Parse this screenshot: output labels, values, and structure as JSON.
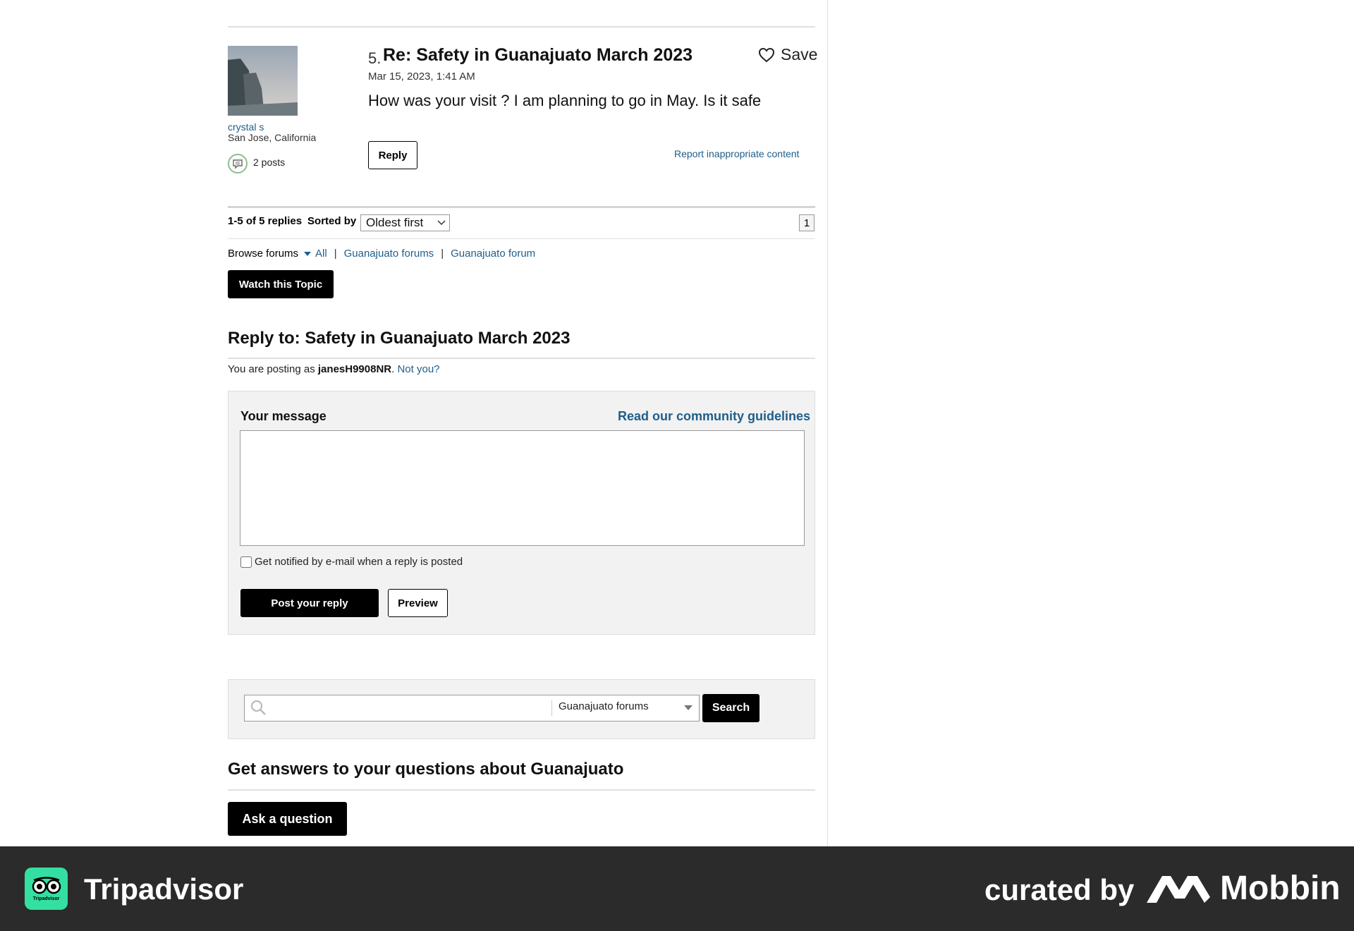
{
  "post": {
    "number": "5.",
    "title": "Re: Safety in Guanajuato March 2023",
    "save_label": "Save",
    "date": "Mar 15, 2023, 1:41 AM",
    "body": "How was your visit ? I am planning to go in May. Is it safe",
    "reply_label": "Reply",
    "report_label": "Report inappropriate content",
    "author": {
      "name": "crystal s",
      "location": "San Jose, California",
      "posts": "2 posts"
    }
  },
  "pagination": {
    "count": "1-5 of 5 replies",
    "sorted_by_label": "Sorted by",
    "sort_value": "Oldest first",
    "page": "1"
  },
  "browse": {
    "label": "Browse forums",
    "all": "All",
    "link1": "Guanajuato forums",
    "link2": "Guanajuato forum",
    "sep": "|"
  },
  "watch_label": "Watch this Topic",
  "reply_form": {
    "heading": "Reply to: Safety in Guanajuato March 2023",
    "posting_prefix": "You are posting as",
    "username": "janesH9908NR",
    "not_you": "Not you?",
    "message_label": "Your message",
    "guidelines": "Read our community guidelines",
    "message_value": "",
    "notify_label": "Get notified by e-mail when a reply is posted",
    "post_label": "Post your reply",
    "preview_label": "Preview"
  },
  "search": {
    "placeholder": "",
    "scope": "Guanajuato forums",
    "button": "Search"
  },
  "answers": {
    "heading": "Get answers to your questions about Guanajuato",
    "ask_label": "Ask a question"
  },
  "footer": {
    "brand": "Tripadvisor",
    "logo_text": "Tripadvisor",
    "curated": "curated by",
    "mobbin": "Mobbin"
  },
  "colors": {
    "link": "#1e5e8b",
    "footer_bg": "#2b2b2b",
    "tripadvisor_green": "#34e0a1"
  }
}
